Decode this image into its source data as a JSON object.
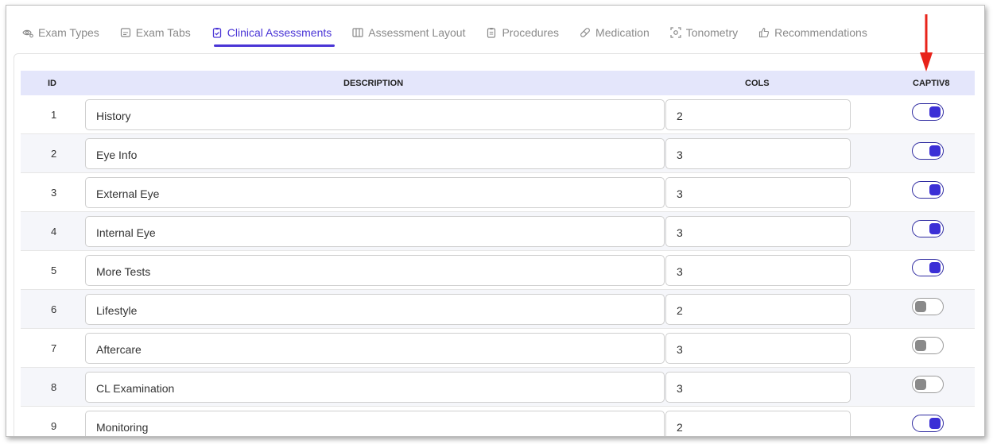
{
  "tabs": [
    {
      "label": "Exam Types",
      "icon": "eye-gear-icon"
    },
    {
      "label": "Exam Tabs",
      "icon": "tab-icon"
    },
    {
      "label": "Clinical Assessments",
      "icon": "clipboard-check-icon",
      "active": true
    },
    {
      "label": "Assessment Layout",
      "icon": "columns-icon"
    },
    {
      "label": "Procedures",
      "icon": "clipboard-list-icon"
    },
    {
      "label": "Medication",
      "icon": "pill-icon"
    },
    {
      "label": "Tonometry",
      "icon": "focus-icon"
    },
    {
      "label": "Recommendations",
      "icon": "thumbs-up-icon"
    }
  ],
  "table": {
    "headers": {
      "id": "ID",
      "description": "DESCRIPTION",
      "cols": "COLS",
      "captiv8": "CAPTIV8"
    },
    "rows": [
      {
        "id": "1",
        "description": "History",
        "cols": "2",
        "captiv8": true
      },
      {
        "id": "2",
        "description": "Eye Info",
        "cols": "3",
        "captiv8": true
      },
      {
        "id": "3",
        "description": "External Eye",
        "cols": "3",
        "captiv8": true
      },
      {
        "id": "4",
        "description": "Internal Eye",
        "cols": "3",
        "captiv8": true
      },
      {
        "id": "5",
        "description": "More Tests",
        "cols": "3",
        "captiv8": true
      },
      {
        "id": "6",
        "description": "Lifestyle",
        "cols": "2",
        "captiv8": false
      },
      {
        "id": "7",
        "description": "Aftercare",
        "cols": "3",
        "captiv8": false
      },
      {
        "id": "8",
        "description": "CL Examination",
        "cols": "3",
        "captiv8": false
      },
      {
        "id": "9",
        "description": "Monitoring",
        "cols": "2",
        "captiv8": true
      }
    ]
  },
  "colors": {
    "accent": "#4a35d6",
    "header_bg": "#e4e6fb",
    "arrow": "#e8231a"
  }
}
